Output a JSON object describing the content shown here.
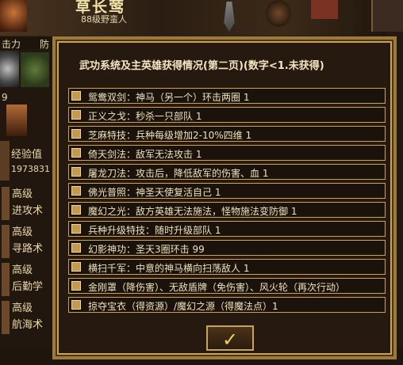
{
  "background": {
    "hero_name": "草长莺",
    "hero_class": "88级野蛮人",
    "stat_attack": "击力",
    "stat_defense": "防",
    "small_number": "9",
    "experience_label": "经验值",
    "experience_value": "1973831",
    "skills": [
      {
        "line1": "高级",
        "line2": "进攻术"
      },
      {
        "line1": "高级",
        "line2": "寻路术"
      },
      {
        "line1": "高级",
        "line2": "后勤学"
      },
      {
        "line1": "高级",
        "line2": "航海术"
      }
    ]
  },
  "dialog": {
    "title": "武功系统及主英雄获得情况(第二页)(数字<1.未获得)",
    "rows": [
      "鸳鸯双剑：神马（另一个）环击两圈 1",
      "正义之戈：秒杀一只部队 1",
      "芝麻特技：兵种每级增加2-10%四维 1",
      "倚天剑法：敌军无法攻击 1",
      "屠龙刀法：攻击后，降低敌军的伤害、血 1",
      "佛光普照：神圣天使复活自己 1",
      "魔幻之光：敌方英雄无法施法，怪物施法变防御 1",
      "兵种升级特技：随时升级部队 1",
      "幻影神功：圣天3圈环击 99",
      "横扫千军：中意的神马横向扫荡敌人 1",
      "金刚罩（降伤害）、无敌盾牌（免伤害）、风火轮（再次行动）",
      "掠夺宝衣（得资源）/魔幻之源（得魔法点）1"
    ],
    "ok_button": "✓"
  }
}
